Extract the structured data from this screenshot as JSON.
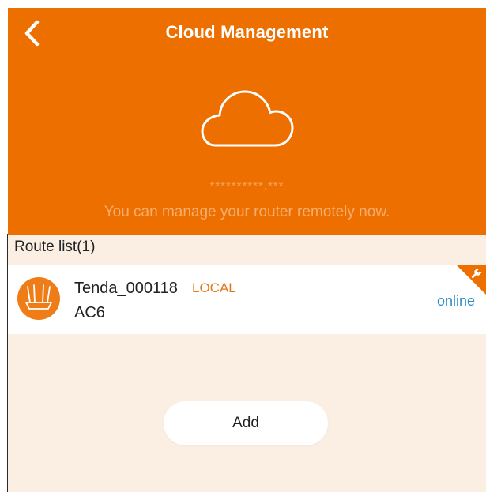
{
  "header": {
    "title": "Cloud Management",
    "back_icon": "chevron-left-icon",
    "cloud_icon": "cloud-icon",
    "masked_account": "**********.***",
    "status_message": "You can manage your router remotely now."
  },
  "route_list": {
    "title": "Route list(1)",
    "items": [
      {
        "name": "Tenda_000118",
        "badge": "LOCAL",
        "model": "AC6",
        "status": "online",
        "icon": "router-icon",
        "corner_icon": "wrench-icon"
      }
    ]
  },
  "actions": {
    "add_label": "Add"
  },
  "colors": {
    "header_bg": "#ed6f00",
    "page_bg": "#fbeee3",
    "local_badge": "#e07a1a",
    "online_status": "#2e8fc7",
    "white": "#ffffff"
  }
}
